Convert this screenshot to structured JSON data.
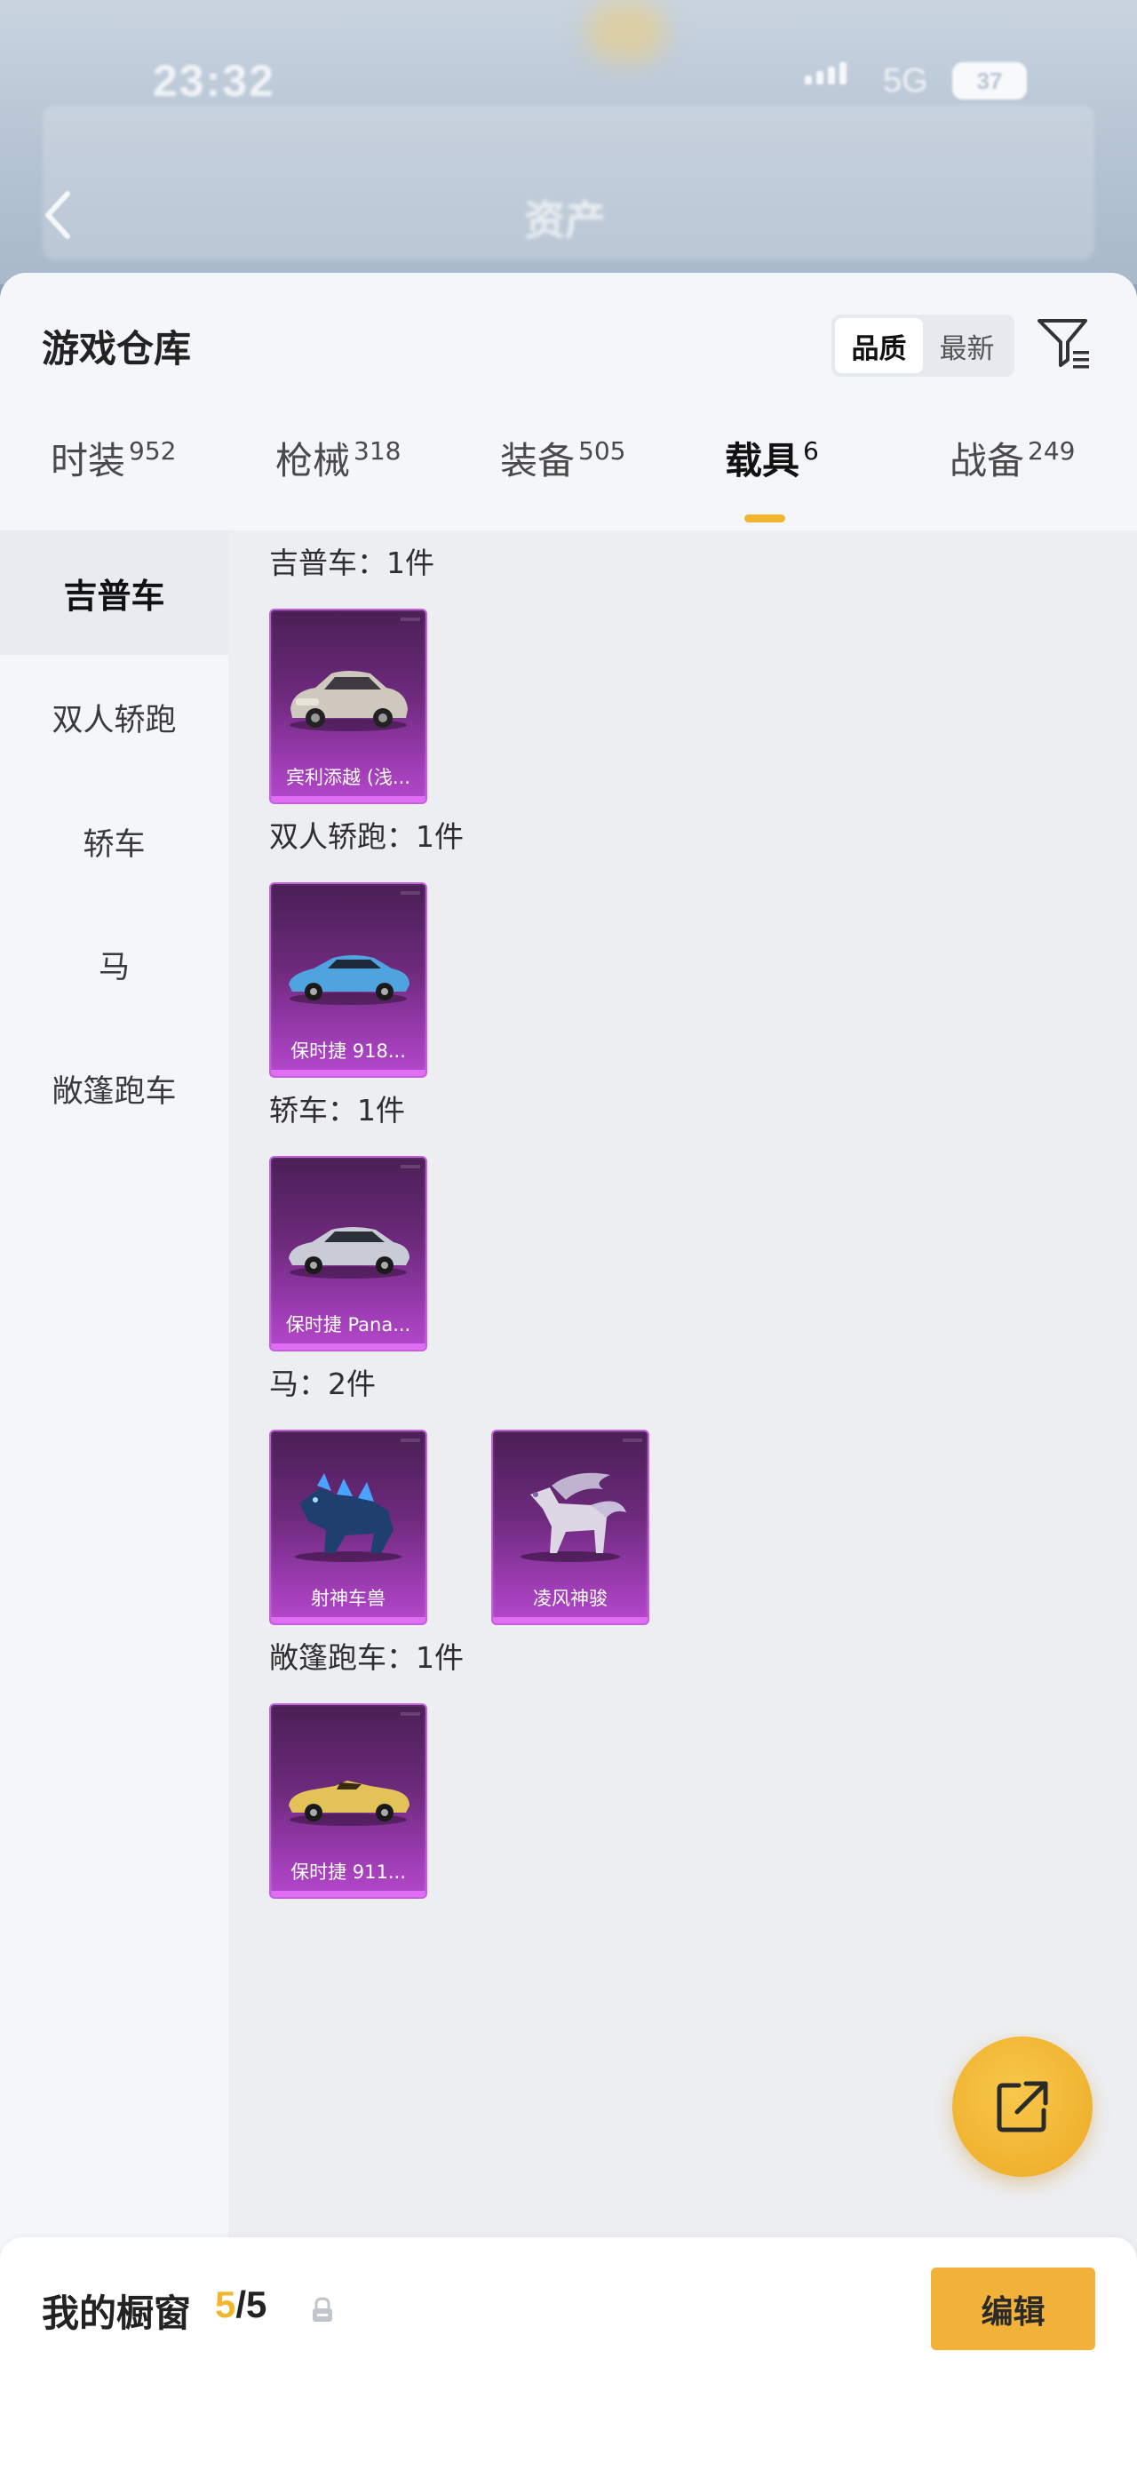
{
  "status_bar": {
    "time": "23:32",
    "network": "5G",
    "battery": "37"
  },
  "header": {
    "title": "资产"
  },
  "warehouse": {
    "title": "游戏仓库",
    "sort": [
      "品质",
      "最新"
    ],
    "tabs": [
      {
        "label": "时装",
        "count": "952"
      },
      {
        "label": "枪械",
        "count": "318"
      },
      {
        "label": "装备",
        "count": "505"
      },
      {
        "label": "载具",
        "count": "6"
      },
      {
        "label": "战备",
        "count": "249"
      }
    ],
    "categories": [
      "吉普车",
      "双人轿跑",
      "轿车",
      "马",
      "敞篷跑车"
    ],
    "groups": [
      {
        "title": "吉普车：1件",
        "items": [
          {
            "name": "宾利添越 (浅...",
            "art": "suv-silver"
          }
        ]
      },
      {
        "title": "双人轿跑：1件",
        "items": [
          {
            "name": "保时捷 918...",
            "art": "coupe-blue"
          }
        ]
      },
      {
        "title": "轿车：1件",
        "items": [
          {
            "name": "保时捷 Pana...",
            "art": "sedan-silver"
          }
        ]
      },
      {
        "title": "马：2件",
        "items": [
          {
            "name": "射神车兽",
            "art": "beast-blue"
          },
          {
            "name": "凌风神骏",
            "art": "horse-white"
          }
        ]
      },
      {
        "title": "敞篷跑车：1件",
        "items": [
          {
            "name": "保时捷 911...",
            "art": "convertible-gold"
          }
        ]
      }
    ]
  },
  "showcase": {
    "label": "我的橱窗",
    "current": "5",
    "total": "/5",
    "edit_label": "编辑"
  },
  "colors": {
    "accent": "#f2b62e",
    "card_purple": "#9a3bb0",
    "fab": "#f0b230"
  },
  "icons": {
    "back": "chevron-left-icon",
    "filter": "filter-icon",
    "share": "share-external-icon",
    "lock": "lock-icon"
  }
}
